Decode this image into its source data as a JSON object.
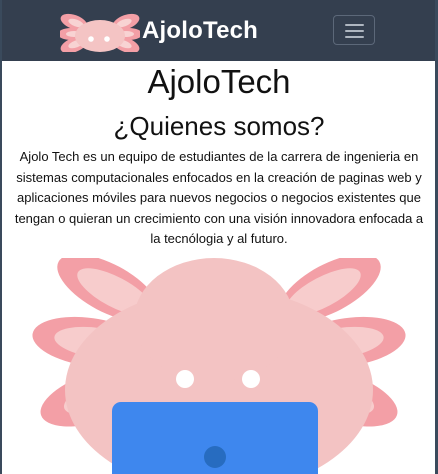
{
  "navbar": {
    "brand_text": "AjoloTech",
    "logo_icon": "axolotl-logo-icon",
    "toggler_icon": "hamburger-menu-icon"
  },
  "main": {
    "title": "AjoloTech",
    "section_title": "¿Quienes somos?",
    "description": "Ajolo Tech es un equipo de estudiantes de la carrera de ingenieria en sistemas computacionales enfocados en la creación de paginas web y aplicaciones móviles para nuevos negocios o negocios existentes que tengan o quieran un crecimiento con una visión innovadora enfocada a la tecnólogia y al futuro.",
    "illustration_icon": "axolotl-laptop-illustration"
  },
  "colors": {
    "navbar": "#343f4f",
    "axolotl_body": "#f2c4c4",
    "axolotl_gill": "#f39fa6",
    "laptop": "#3e87ee",
    "laptop_camera": "#276cc0"
  }
}
